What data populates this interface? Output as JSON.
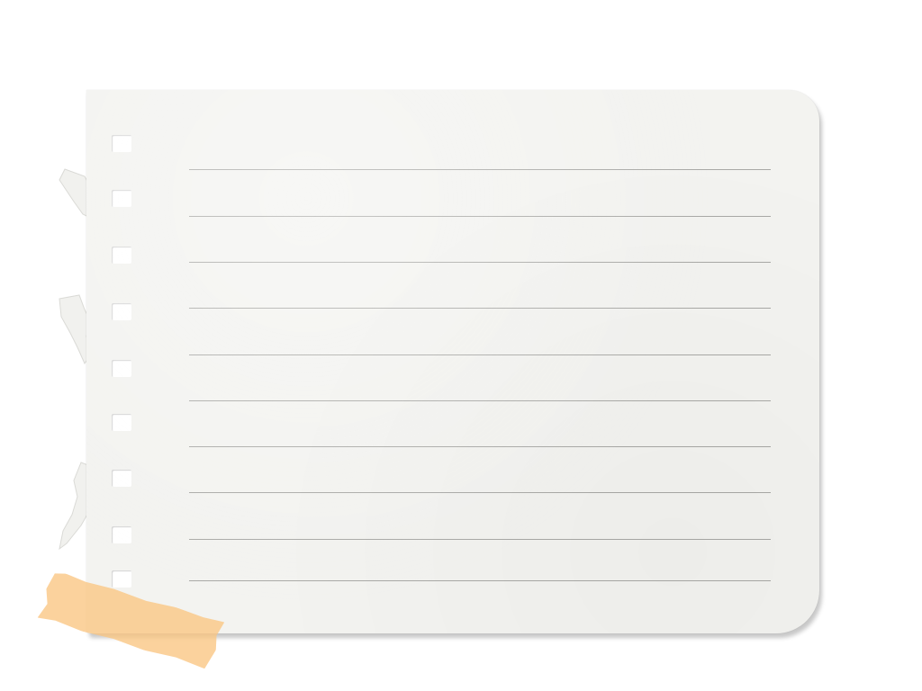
{
  "note": {
    "ruled_line_count": 10,
    "punch_hole_count": 9,
    "paper_color": "#f3f3f0",
    "line_color": "#a9a9a6",
    "tape_color": "#f8c180"
  }
}
